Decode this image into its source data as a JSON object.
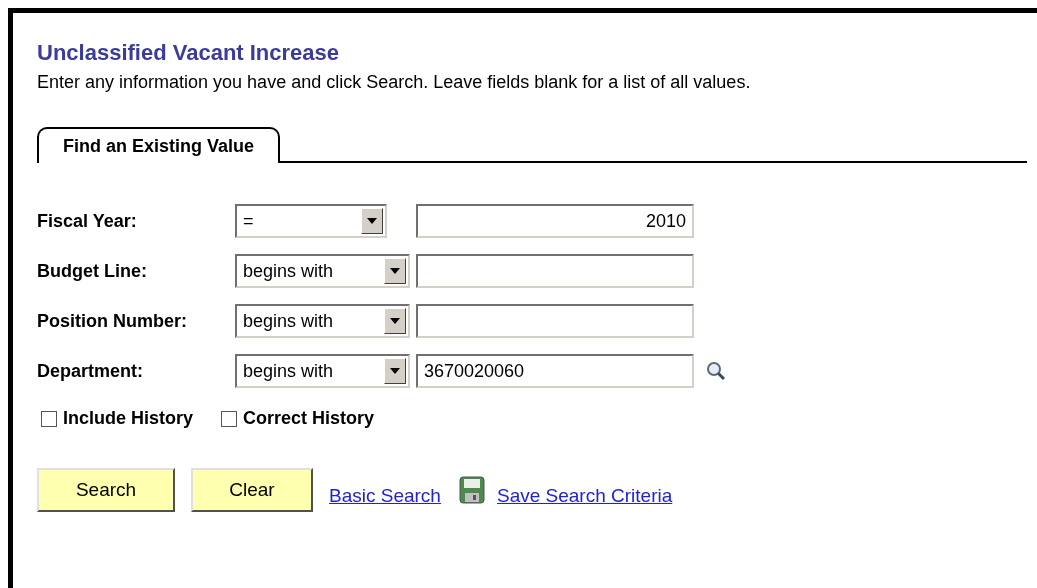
{
  "title": "Unclassified Vacant Increase",
  "instructions": "Enter any information you have and click Search. Leave fields blank for a list of all values.",
  "tabs": [
    {
      "label": "Find an Existing Value",
      "selected": true
    }
  ],
  "fields": [
    {
      "label": "Fiscal Year:",
      "operator": "=",
      "value": "2010",
      "kind": "number",
      "lookup": false
    },
    {
      "label": "Budget Line:",
      "operator": "begins with",
      "kind": "text",
      "lookup": false
    },
    {
      "label": "Position Number:",
      "operator": "begins with",
      "kind": "text",
      "lookup": false
    },
    {
      "label": "Department:",
      "operator": "begins with",
      "value": "3670020060",
      "kind": "text",
      "lookup": true
    }
  ],
  "checkboxes": [
    {
      "label": "Include History",
      "checked": false
    },
    {
      "label": "Correct History",
      "checked": false
    }
  ],
  "buttons": [
    "Search",
    "Clear"
  ],
  "links": [
    {
      "label": "Basic Search",
      "icon": false
    },
    {
      "label": "Save Search Criteria",
      "icon": true
    }
  ]
}
